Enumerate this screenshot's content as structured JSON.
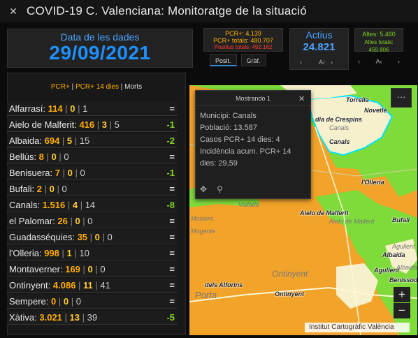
{
  "header": {
    "title": "COVID-19 C. Valenciana: Monitoratge de la situació",
    "logo_icon": "gva-logo-icon"
  },
  "date_panel": {
    "label": "Data de les dades",
    "value": "29/09/2021"
  },
  "pcr_panel": {
    "line1": "PCR+: 4.139",
    "line2": "PCR+ totals: 480.707",
    "line3": "Positius totals: 492.162"
  },
  "tabs": [
    {
      "label": "Posit."
    },
    {
      "label": "Gràf."
    }
  ],
  "actius": {
    "title": "Actius",
    "value": "24.821",
    "nav_prev": "‹",
    "nav_mid": "A‹",
    "nav_next": "›"
  },
  "altes": {
    "line1": "Altes: 5.460",
    "line2": "Altes totals: 459.806",
    "nav_prev": "‹",
    "nav_mid": "A‹",
    "nav_next": "›"
  },
  "list_header": {
    "pcr": "PCR+",
    "sep1": " | ",
    "pcr14": "PCR+ 14 dies",
    "sep2": " | ",
    "morts": "Morts"
  },
  "rows": [
    {
      "name": "Alfarrasí:",
      "pcr": "114",
      "p14": "0",
      "morts": "1",
      "trend": "="
    },
    {
      "name": "Aielo de Malferit:",
      "pcr": "416",
      "p14": "3",
      "morts": "5",
      "trend": "-1"
    },
    {
      "name": "Albaida:",
      "pcr": "694",
      "p14": "5",
      "morts": "15",
      "trend": "-2"
    },
    {
      "name": "Bellús:",
      "pcr": "8",
      "p14": "0",
      "morts": "0",
      "trend": "="
    },
    {
      "name": "Benisuera:",
      "pcr": "7",
      "p14": "0",
      "morts": "0",
      "trend": "-1"
    },
    {
      "name": "Bufali:",
      "pcr": "2",
      "p14": "0",
      "morts": "0",
      "trend": "="
    },
    {
      "name": "Canals:",
      "pcr": "1.516",
      "p14": "4",
      "morts": "14",
      "trend": "-8"
    },
    {
      "name": "el Palomar:",
      "pcr": "26",
      "p14": "0",
      "morts": "0",
      "trend": "="
    },
    {
      "name": "Guadasséquies:",
      "pcr": "35",
      "p14": "0",
      "morts": "0",
      "trend": "="
    },
    {
      "name": "l'Olleria:",
      "pcr": "998",
      "p14": "1",
      "morts": "10",
      "trend": "="
    },
    {
      "name": "Montaverner:",
      "pcr": "169",
      "p14": "0",
      "morts": "0",
      "trend": "="
    },
    {
      "name": "Ontinyent:",
      "pcr": "4.086",
      "p14": "11",
      "morts": "41",
      "trend": "="
    },
    {
      "name": "Sempere:",
      "pcr": "0",
      "p14": "0",
      "morts": "0",
      "trend": "="
    },
    {
      "name": "Xàtiva:",
      "pcr": "3.021",
      "p14": "13",
      "morts": "39",
      "trend": "-5"
    }
  ],
  "popup": {
    "title": "Mostrando 1",
    "lines": [
      "Municipi: Canals",
      "Població: 13.587",
      "Casos PCR+ 14 dies: 4",
      "Incidència acum. PCR+ 14 dies: 29,59"
    ]
  },
  "map": {
    "labels": [
      "Torrella",
      "Novetlè",
      "Canals",
      "l'Olleria",
      "Aielo de Malferit",
      "Bufali",
      "Albaida",
      "Agullent",
      "Benissoda",
      "Ontinyent",
      "Ontinyent",
      "Aielo de Malferit",
      "Agullent",
      "Albaida",
      "Vallada",
      "Mogente",
      "Moixent",
      "Torrella",
      "dia de Crespins",
      "dels Alforins",
      "Porta"
    ],
    "more_label": "···",
    "zoom_in": "+",
    "zoom_out": "−",
    "credit": "Institut Cartogràfic València"
  },
  "colors": {
    "accent": "#1e90ff",
    "orange": "#ffae00",
    "green": "#7ed321",
    "red": "#ff3b2f",
    "map_orange": "#f2a32a",
    "map_green": "#7edb3a",
    "map_cream": "#f7f0cc"
  }
}
